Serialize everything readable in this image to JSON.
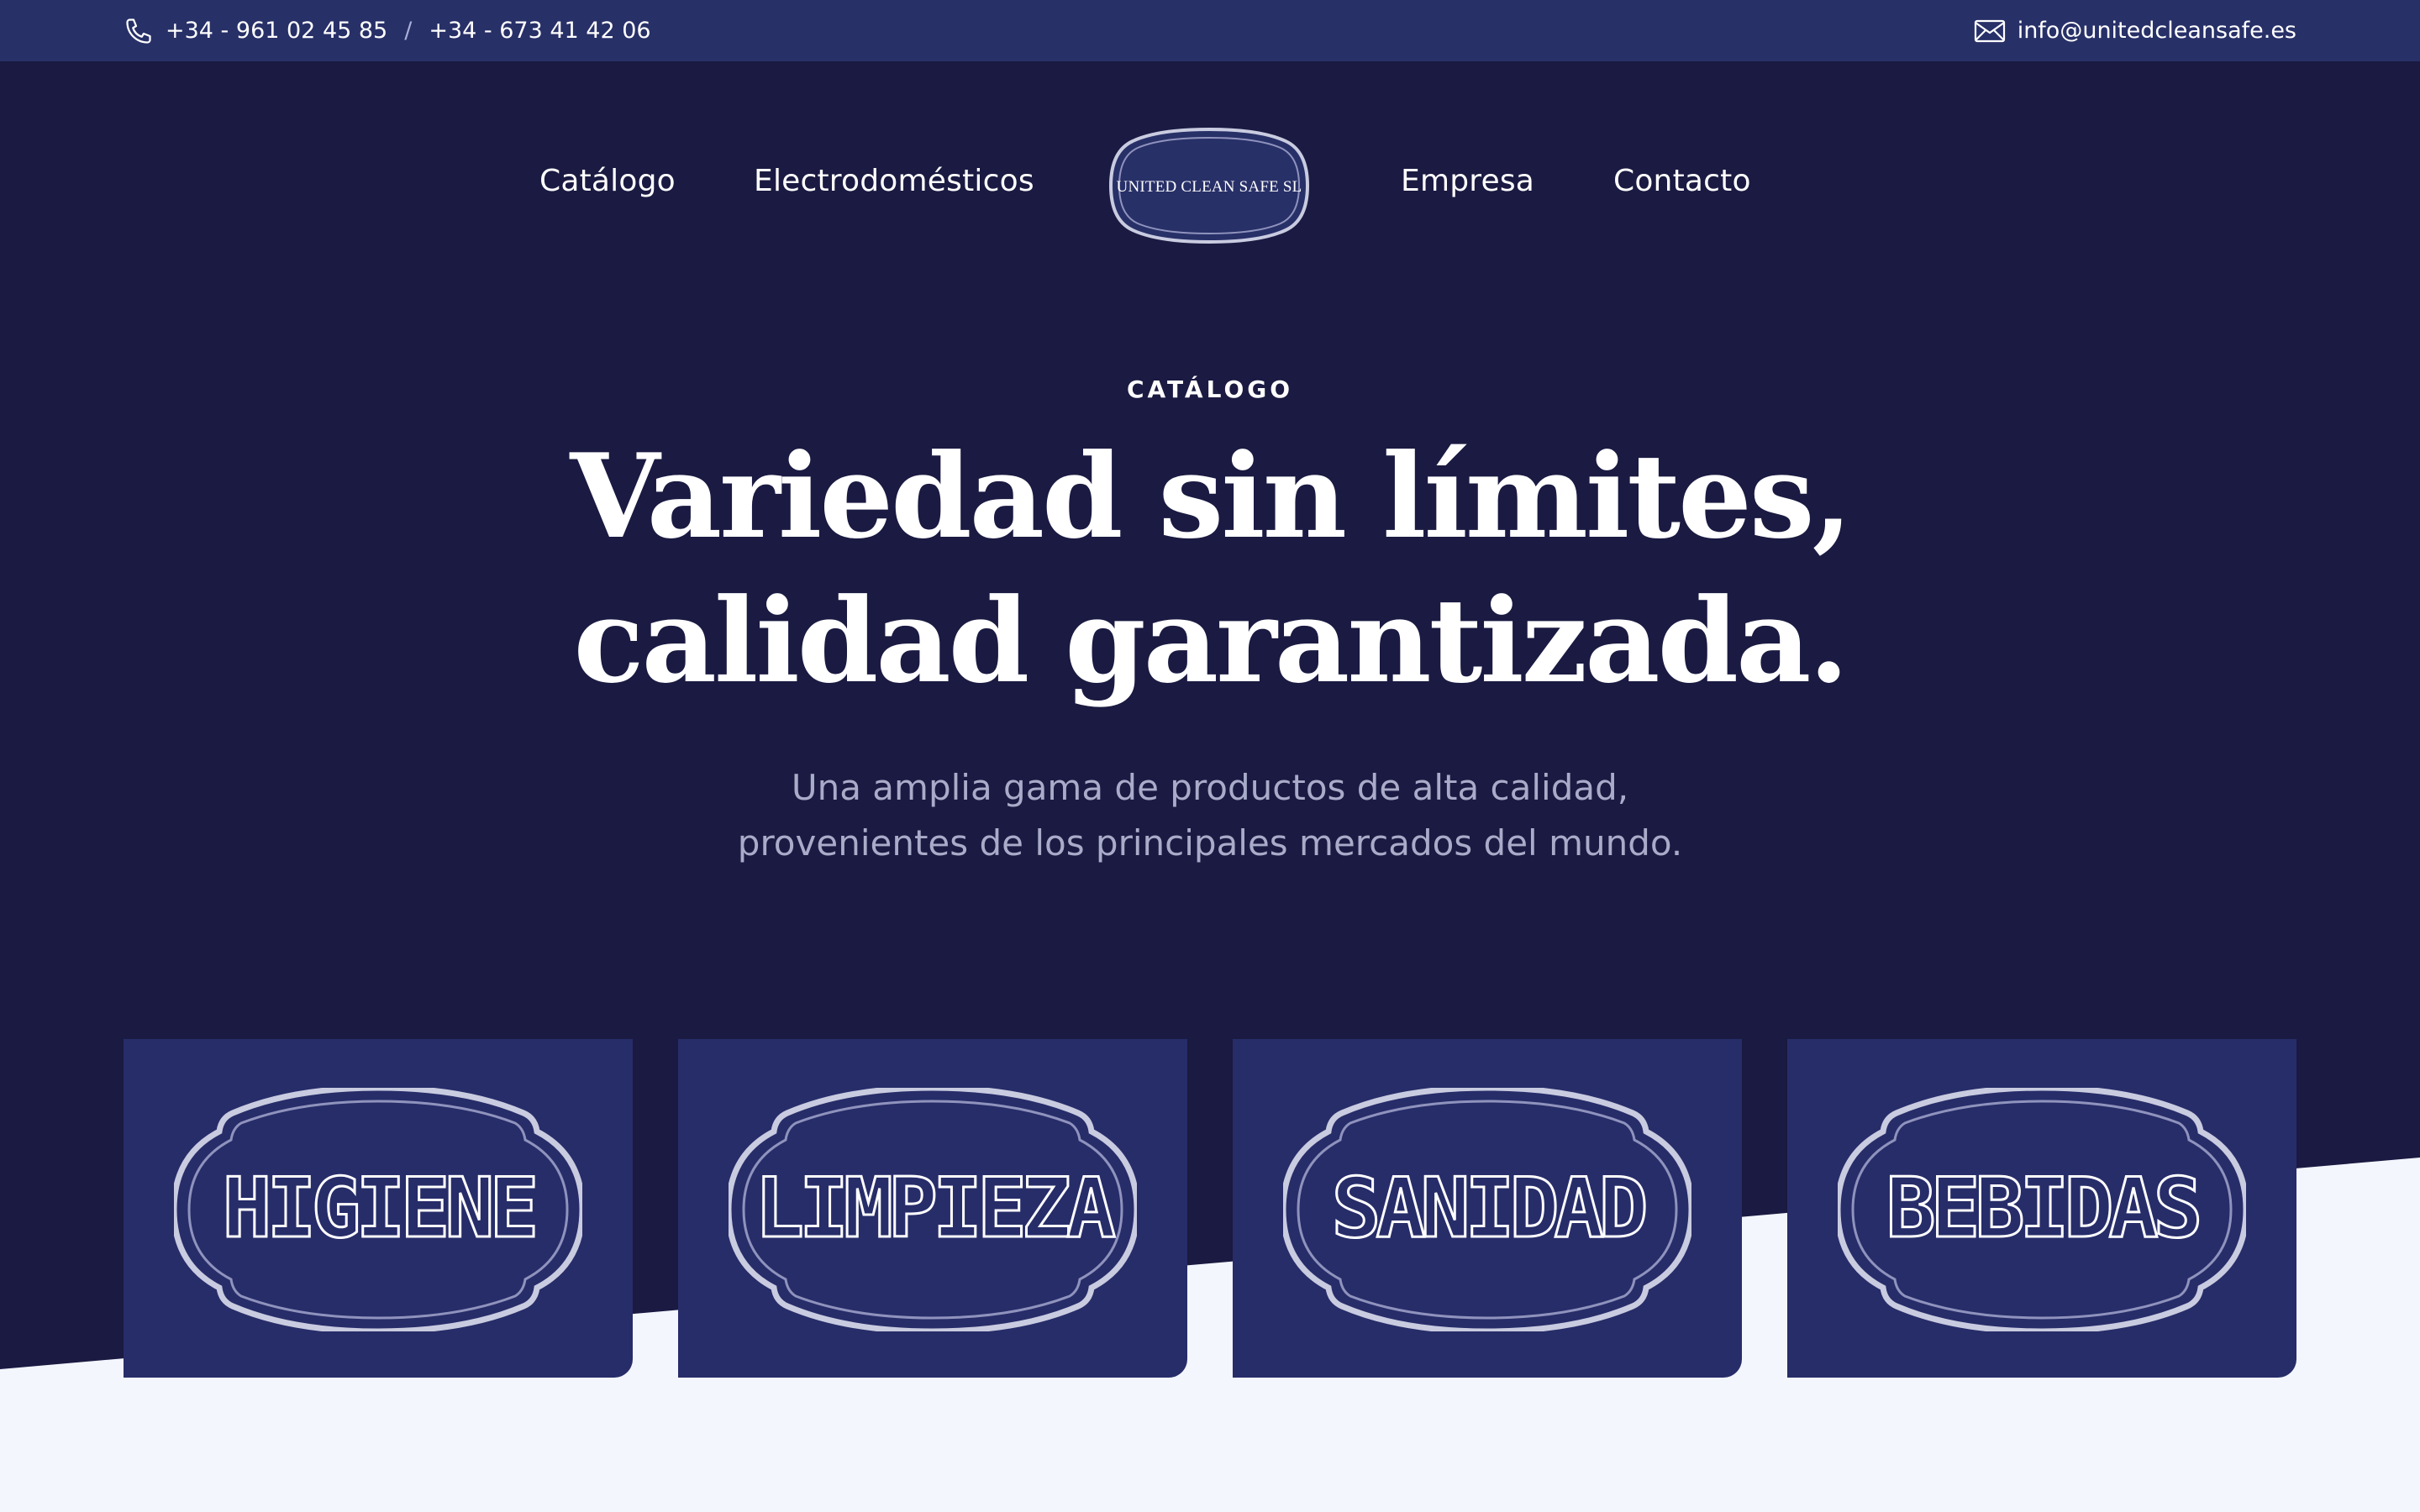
{
  "topbar": {
    "phone1": "+34 - 961 02 45 85",
    "separator": "/",
    "phone2": "+34 - 673 41 42 06",
    "email": "info@unitedcleansafe.es",
    "icons": {
      "phone": "phone-icon",
      "email": "envelope-icon"
    }
  },
  "nav": {
    "items": [
      "Catálogo",
      "Electrodomésticos",
      "Empresa",
      "Contacto"
    ],
    "logo_text": "UNITED CLEAN SAFE SL"
  },
  "hero": {
    "eyebrow": "CATÁLOGO",
    "headline_line1": "Variedad sin límites,",
    "headline_line2": "calidad garantizada.",
    "sub_line1": "Una amplia gama de productos de alta calidad,",
    "sub_line2": "provenientes de los principales mercados del mundo."
  },
  "categories": [
    {
      "label": "HIGIENE"
    },
    {
      "label": "LIMPIEZA"
    },
    {
      "label": "SANIDAD"
    },
    {
      "label": "BEBIDAS"
    }
  ],
  "colors": {
    "topbar": "#283068",
    "hero": "#1a1a42",
    "card": "#272d69",
    "page": "#f3f6fd",
    "subtext": "#a9abc9"
  }
}
